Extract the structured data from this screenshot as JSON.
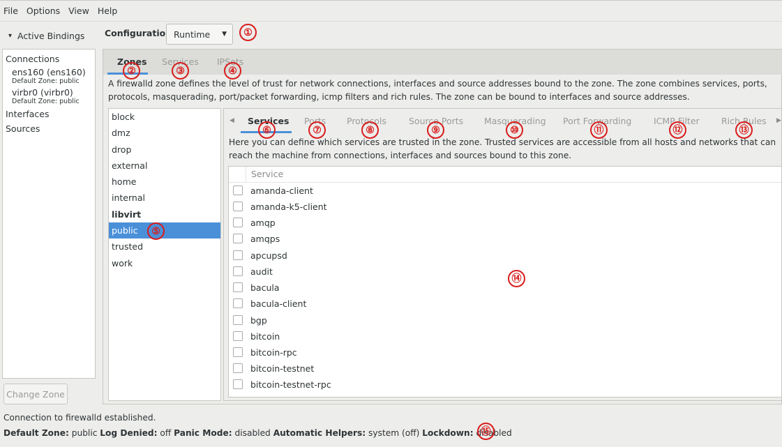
{
  "menubar": {
    "items": [
      "File",
      "Options",
      "View",
      "Help"
    ]
  },
  "sidebar": {
    "bindings_toggle": "Active Bindings",
    "connections_header": "Connections",
    "connections": [
      {
        "name": "ens160 (ens160)",
        "zone": "Default Zone: public"
      },
      {
        "name": "virbr0 (virbr0)",
        "zone": "Default Zone: public"
      }
    ],
    "interfaces_header": "Interfaces",
    "sources_header": "Sources",
    "change_zone_button": "Change Zone"
  },
  "configuration": {
    "label": "Configuration:",
    "value": "Runtime"
  },
  "top_tabs": [
    "Zones",
    "Services",
    "IPSets"
  ],
  "zone_description": "A firewalld zone defines the level of trust for network connections, interfaces and source addresses bound to the zone. The zone combines services, ports, protocols, masquerading, port/packet forwarding, icmp filters and rich rules. The zone can be bound to interfaces and source addresses.",
  "zones": [
    "block",
    "dmz",
    "drop",
    "external",
    "home",
    "internal",
    "libvirt",
    "public",
    "trusted",
    "work"
  ],
  "selected_zone": "public",
  "inner_tabs": [
    "Services",
    "Ports",
    "Protocols",
    "Source Ports",
    "Masquerading",
    "Port Forwarding",
    "ICMP Filter",
    "Rich Rules"
  ],
  "services_description": "Here you can define which services are trusted in the zone. Trusted services are accessible from all hosts and networks that can reach the machine from connections, interfaces and sources bound to this zone.",
  "service_table": {
    "column_header": "Service",
    "rows": [
      "amanda-client",
      "amanda-k5-client",
      "amqp",
      "amqps",
      "apcupsd",
      "audit",
      "bacula",
      "bacula-client",
      "bgp",
      "bitcoin",
      "bitcoin-rpc",
      "bitcoin-testnet",
      "bitcoin-testnet-rpc"
    ]
  },
  "status": {
    "connection": "Connection to firewalld established.",
    "default_zone_label": "Default Zone:",
    "default_zone_value": "public",
    "log_denied_label": "Log Denied:",
    "log_denied_value": "off",
    "panic_mode_label": "Panic Mode:",
    "panic_mode_value": "disabled",
    "helpers_label": "Automatic Helpers:",
    "helpers_value": "system (off)",
    "lockdown_label": "Lockdown:",
    "lockdown_value": "disabled"
  },
  "callouts": [
    "①",
    "②",
    "③",
    "④",
    "⑤",
    "⑥",
    "⑦",
    "⑧",
    "⑨",
    "⑩",
    "⑪",
    "⑫",
    "⑬",
    "⑭",
    "⑮"
  ],
  "colors": {
    "accent": "#4a90d9",
    "callout": "#d91c1c"
  }
}
